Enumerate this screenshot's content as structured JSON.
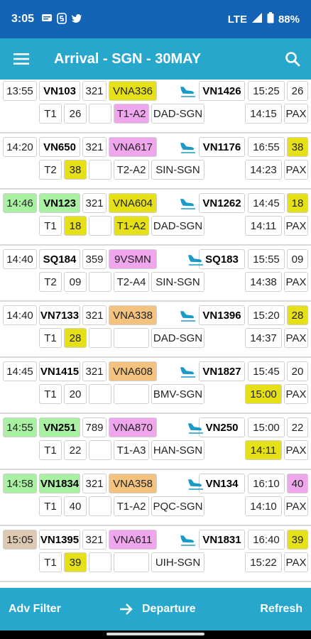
{
  "status_bar": {
    "time": "3:05",
    "network": "LTE",
    "battery": "88%"
  },
  "app_bar": {
    "title": "Arrival - SGN - 30MAY"
  },
  "colors": {
    "yellow": "#e6e017",
    "green": "#a9f0a2",
    "pink": "#f0a6ec",
    "orange": "#f2c27e",
    "tan": "#ddc9b2",
    "white": "#ffffff"
  },
  "flights": [
    {
      "sta": "13:55",
      "flight": "VN103",
      "ac": "321",
      "reg": "VNA336",
      "dep_flight": "VN1426",
      "std": "15:25",
      "gate": "26",
      "term": "T1",
      "stand": "26",
      "blank": "",
      "slot": "T1-A2",
      "route": "DAD-SGN",
      "eta": "14:15",
      "pax": "PAX",
      "c_sta": "white",
      "c_flight": "white",
      "c_reg": "yellow",
      "c_stand": "white",
      "c_slot": "pink",
      "c_gate": "white",
      "c_eta": "white"
    },
    {
      "sta": "14:20",
      "flight": "VN650",
      "ac": "321",
      "reg": "VNA617",
      "dep_flight": "VN1176",
      "std": "16:55",
      "gate": "38",
      "term": "T2",
      "stand": "38",
      "blank": "",
      "slot": "T2-A2",
      "route": "SIN-SGN",
      "eta": "14:23",
      "pax": "PAX",
      "c_sta": "white",
      "c_flight": "white",
      "c_reg": "pink",
      "c_stand": "yellow",
      "c_slot": "white",
      "c_gate": "yellow",
      "c_eta": "white"
    },
    {
      "sta": "14:46",
      "flight": "VN123",
      "ac": "321",
      "reg": "VNA604",
      "dep_flight": "VN1262",
      "std": "14:45",
      "gate": "18",
      "term": "T1",
      "stand": "18",
      "blank": "",
      "slot": "T1-A2",
      "route": "DAD-SGN",
      "eta": "14:11",
      "pax": "PAX",
      "c_sta": "green",
      "c_flight": "green",
      "c_reg": "yellow",
      "c_stand": "yellow",
      "c_slot": "yellow",
      "c_gate": "yellow",
      "c_eta": "white"
    },
    {
      "sta": "14:40",
      "flight": "SQ184",
      "ac": "359",
      "reg": "9VSMN",
      "dep_flight": "SQ183",
      "std": "15:55",
      "gate": "09",
      "term": "T2",
      "stand": "09",
      "blank": "",
      "slot": "T2-A4",
      "route": "SIN-SGN",
      "eta": "14:38",
      "pax": "PAX",
      "c_sta": "white",
      "c_flight": "white",
      "c_reg": "pink",
      "c_stand": "white",
      "c_slot": "white",
      "c_gate": "white",
      "c_eta": "white"
    },
    {
      "sta": "14:40",
      "flight": "VN7133",
      "ac": "321",
      "reg": "VNA338",
      "dep_flight": "VN1396",
      "std": "15:20",
      "gate": "28",
      "term": "T1",
      "stand": "28",
      "blank": "",
      "slot": "",
      "route": "DAD-SGN",
      "eta": "14:37",
      "pax": "PAX",
      "c_sta": "white",
      "c_flight": "white",
      "c_reg": "orange",
      "c_stand": "yellow",
      "c_slot": "white",
      "c_gate": "yellow",
      "c_eta": "white"
    },
    {
      "sta": "14:45",
      "flight": "VN1415",
      "ac": "321",
      "reg": "VNA608",
      "dep_flight": "VN1827",
      "std": "15:45",
      "gate": "20",
      "term": "T1",
      "stand": "20",
      "blank": "",
      "slot": "",
      "route": "BMV-SGN",
      "eta": "15:00",
      "pax": "PAX",
      "c_sta": "white",
      "c_flight": "white",
      "c_reg": "orange",
      "c_stand": "white",
      "c_slot": "white",
      "c_gate": "white",
      "c_eta": "yellow"
    },
    {
      "sta": "14:55",
      "flight": "VN251",
      "ac": "789",
      "reg": "VNA870",
      "dep_flight": "VN250",
      "std": "15:00",
      "gate": "22",
      "term": "T1",
      "stand": "22",
      "blank": "",
      "slot": "T1-A3",
      "route": "HAN-SGN",
      "eta": "14:11",
      "pax": "PAX",
      "c_sta": "green",
      "c_flight": "green",
      "c_reg": "pink",
      "c_stand": "white",
      "c_slot": "white",
      "c_gate": "white",
      "c_eta": "yellow"
    },
    {
      "sta": "14:58",
      "flight": "VN1834",
      "ac": "321",
      "reg": "VNA358",
      "dep_flight": "VN134",
      "std": "16:10",
      "gate": "40",
      "term": "T1",
      "stand": "40",
      "blank": "",
      "slot": "T1-A2",
      "route": "PQC-SGN",
      "eta": "14:10",
      "pax": "PAX",
      "c_sta": "green",
      "c_flight": "green",
      "c_reg": "orange",
      "c_stand": "white",
      "c_slot": "white",
      "c_gate": "pink",
      "c_eta": "white"
    },
    {
      "sta": "15:05",
      "flight": "VN1395",
      "ac": "321",
      "reg": "VNA611",
      "dep_flight": "VN1831",
      "std": "16:40",
      "gate": "39",
      "term": "T1",
      "stand": "39",
      "blank": "",
      "slot": "",
      "route": "UIH-SGN",
      "eta": "15:22",
      "pax": "PAX",
      "c_sta": "tan",
      "c_flight": "white",
      "c_reg": "pink",
      "c_stand": "yellow",
      "c_slot": "white",
      "c_gate": "yellow",
      "c_eta": "white"
    }
  ],
  "bottom_bar": {
    "adv_filter": "Adv Filter",
    "departure": "Departure",
    "refresh": "Refresh"
  }
}
